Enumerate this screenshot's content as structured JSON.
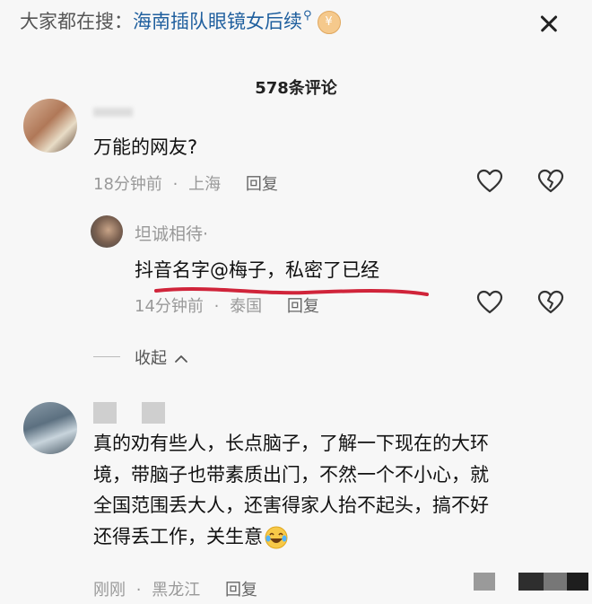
{
  "search": {
    "prefix": "大家都在搜：",
    "term": "海南插队眼镜女后续",
    "search_glyph": "⚲",
    "coin_glyph": "¥"
  },
  "comments_count": "578条评论",
  "comments": [
    {
      "text": "万能的网友?",
      "time": "18分钟前",
      "dot": "·",
      "location": "上海",
      "reply_label": "回复",
      "replies": [
        {
          "name": "坦诚相待·",
          "text": "抖音名字@梅子，私密了已经",
          "time": "14分钟前",
          "dot": "·",
          "location": "泰国",
          "reply_label": "回复"
        }
      ],
      "collapse_label": "收起"
    },
    {
      "text_lines": [
        "真的劝有些人，长点脑子，了解一下现在的大环",
        "境，带脑子也带素质出门，不然一个不小心，就",
        "全国范围丢大人，还害得家人抬不起头，搞不好",
        "还得丢工作，关生意"
      ],
      "time": "刚刚",
      "dot": "·",
      "location": "黑龙江",
      "reply_label": "回复"
    }
  ],
  "colors": {
    "background": "#f7f7f7",
    "search_term": "#1f5f9e",
    "meta_text": "#999999",
    "underline": "#d0243a"
  },
  "icons": [
    "search-icon",
    "coin-icon",
    "close-icon",
    "heart-icon",
    "unlike-icon",
    "chevron-up-icon",
    "laugh-cry-emoji"
  ]
}
